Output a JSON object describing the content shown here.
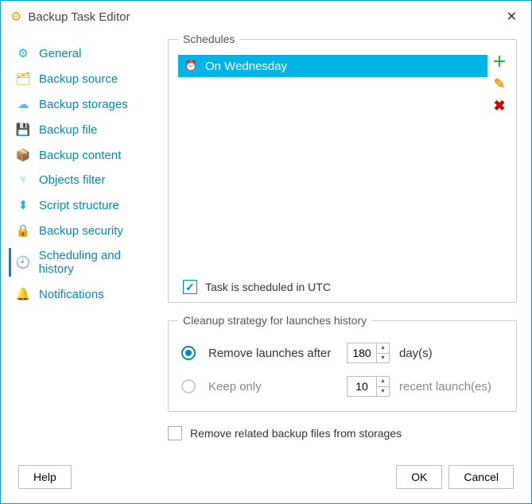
{
  "window": {
    "title": "Backup Task Editor"
  },
  "nav": [
    {
      "icon": "⚙",
      "iconColor": "#17b6df",
      "label": "General",
      "name": "nav-general"
    },
    {
      "icon": "🗂",
      "iconColor": "#f0a30a",
      "label": "Backup source",
      "name": "nav-backup-source"
    },
    {
      "icon": "☁",
      "iconColor": "#56bfe8",
      "label": "Backup storages",
      "name": "nav-backup-storages"
    },
    {
      "icon": "💾",
      "iconColor": "#1e88e5",
      "label": "Backup file",
      "name": "nav-backup-file"
    },
    {
      "icon": "📦",
      "iconColor": "#f0a30a",
      "label": "Backup content",
      "name": "nav-backup-content"
    },
    {
      "icon": "▼",
      "iconColor": "#cfe9f5",
      "label": "Objects filter",
      "name": "nav-objects-filter"
    },
    {
      "icon": "⬍",
      "iconColor": "#17b6df",
      "label": "Script structure",
      "name": "nav-script-structure"
    },
    {
      "icon": "🔒",
      "iconColor": "#f0a30a",
      "label": "Backup security",
      "name": "nav-backup-security"
    },
    {
      "icon": "🕘",
      "iconColor": "#e26b3b",
      "label": "Scheduling and history",
      "name": "nav-scheduling",
      "active": true
    },
    {
      "icon": "🔔",
      "iconColor": "#f0c40a",
      "label": "Notifications",
      "name": "nav-notifications"
    }
  ],
  "schedules": {
    "legend": "Schedules",
    "items": [
      {
        "icon": "⏰",
        "text": "On Wednesday"
      }
    ],
    "utc_label": "Task is scheduled in UTC",
    "utc_checked": true
  },
  "cleanup": {
    "legend": "Cleanup strategy for launches history",
    "option1_label": "Remove launches after",
    "option1_value": "180",
    "option1_suffix": "day(s)",
    "option2_label": "Keep only",
    "option2_value": "10",
    "option2_suffix": "recent launch(es)",
    "selected": 1
  },
  "remove_related": {
    "label": "Remove related backup files from storages",
    "checked": false
  },
  "footer": {
    "help": "Help",
    "ok": "OK",
    "cancel": "Cancel"
  }
}
